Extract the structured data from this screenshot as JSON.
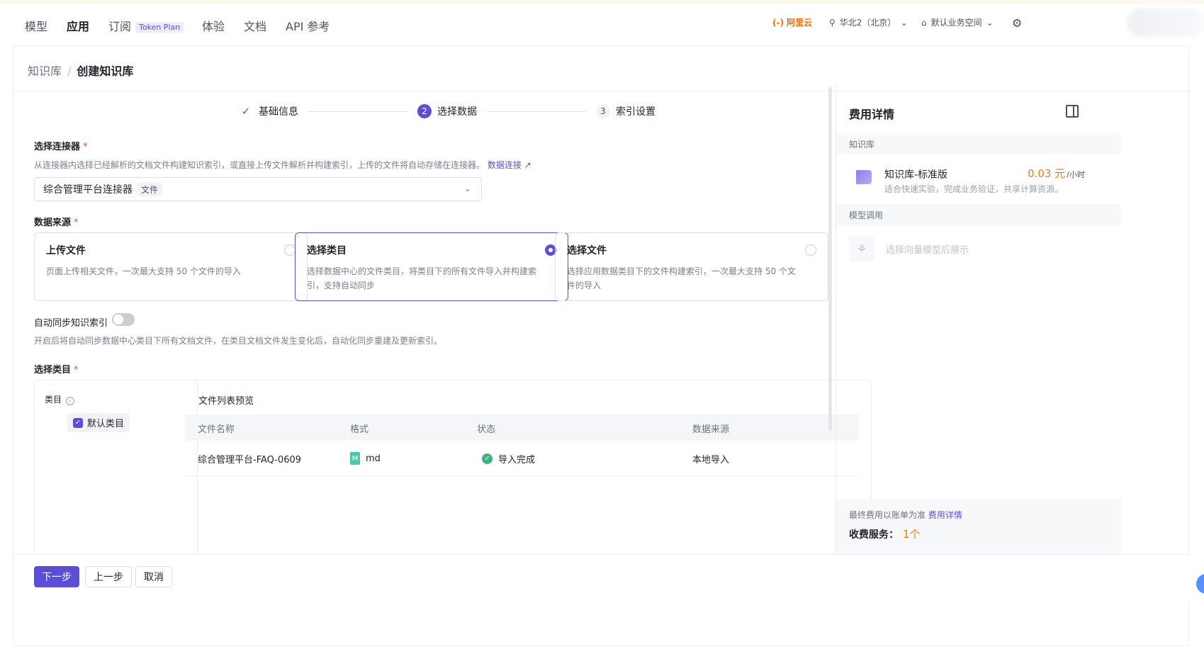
{
  "nav": {
    "items": [
      "模型",
      "应用",
      "订阅",
      "体验",
      "文档",
      "API 参考"
    ],
    "active": "应用",
    "plan_badge": "Token Plan",
    "logo": "(-) 阿里云",
    "region": "华北2（北京）",
    "workspace": "默认业务空间"
  },
  "breadcrumb": {
    "parent": "知识库",
    "current": "创建知识库"
  },
  "steps": [
    {
      "label": "基础信息",
      "num": "✓"
    },
    {
      "label": "选择数据",
      "num": "2"
    },
    {
      "label": "索引设置",
      "num": "3"
    }
  ],
  "connector": {
    "label": "选择连接器",
    "hint": "从连接器内选择已经解析的文档文件构建知识索引，或直接上传文件解析并构建索引，上传的文件将自动存储在连接器。",
    "link": "数据连接",
    "selected": "综合管理平台连接器",
    "selected_tag": "文件"
  },
  "source": {
    "label": "数据来源",
    "options": [
      {
        "title": "上传文件",
        "desc": "页面上传相关文件，一次最大支持 50 个文件的导入"
      },
      {
        "title": "选择类目",
        "desc": "选择数据中心的文件类目，将类目下的所有文件导入并构建索引，支持自动同步"
      },
      {
        "title": "选择文件",
        "desc": "选择应用数据类目下的文件构建索引，一次最大支持 50 个文件的导入"
      }
    ]
  },
  "sync": {
    "label": "自动同步知识索引",
    "hint": "开启后将自动同步数据中心类目下所有文档文件，在类目文档文件发生变化后，自动化同步重建及更新索引。"
  },
  "category": {
    "label": "选择类目",
    "tree_title": "类目",
    "item": "默认类目",
    "preview_title": "文件列表预览",
    "columns": [
      "文件名称",
      "格式",
      "状态",
      "数据来源"
    ],
    "rows": [
      {
        "name": "综合管理平台-FAQ-0609",
        "format": "md",
        "status": "导入完成",
        "source": "本地导入"
      }
    ]
  },
  "footer": {
    "next": "下一步",
    "prev": "上一步",
    "cancel": "取消"
  },
  "side": {
    "title": "费用详情",
    "kb_section": "知识库",
    "plan_name": "知识库-标准版",
    "plan_price": "0.03 元",
    "plan_unit": "/小时",
    "plan_desc": "适合快速实验，完成业务验证，共享计算资源。",
    "model_section": "模型调用",
    "model_placeholder": "选择向量模型后展示",
    "fee_note": "最终费用以账单为准",
    "fee_link": "费用详情",
    "fee_count_label": "收费服务：",
    "fee_count": "1个"
  },
  "colors": {
    "accent": "#5b4fd8",
    "price": "#ef7a1a",
    "success": "#3fb27f"
  }
}
